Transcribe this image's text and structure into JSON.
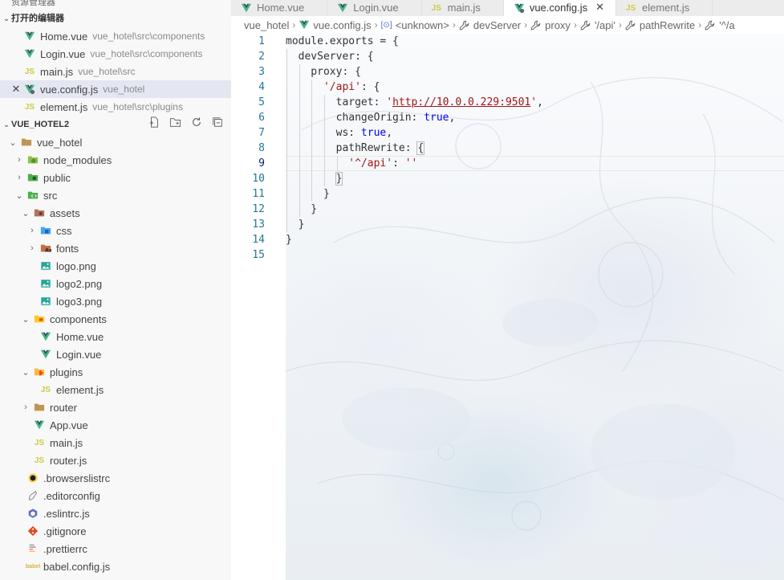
{
  "explorer": {
    "title": "资源管理器",
    "open_editors": {
      "label": "打开的编辑器",
      "items": [
        {
          "name": "Home.vue",
          "path": "vue_hotel\\src\\components",
          "type": "vue"
        },
        {
          "name": "Login.vue",
          "path": "vue_hotel\\src\\components",
          "type": "vue"
        },
        {
          "name": "main.js",
          "path": "vue_hotel\\src",
          "type": "js"
        },
        {
          "name": "vue.config.js",
          "path": "vue_hotel",
          "type": "vueconfig",
          "selected": true
        },
        {
          "name": "element.js",
          "path": "vue_hotel\\src\\plugins",
          "type": "js"
        }
      ]
    },
    "workspace": {
      "label": "VUE_HOTEL2",
      "tree": [
        {
          "name": "vue_hotel",
          "depth": 1,
          "kind": "folder-open",
          "icon": "folder-icon"
        },
        {
          "name": "node_modules",
          "depth": 2,
          "kind": "folder-closed",
          "icon": "node-folder-icon"
        },
        {
          "name": "public",
          "depth": 2,
          "kind": "folder-closed",
          "icon": "public-folder-icon"
        },
        {
          "name": "src",
          "depth": 2,
          "kind": "folder-open",
          "icon": "src-folder-icon"
        },
        {
          "name": "assets",
          "depth": 3,
          "kind": "folder-open",
          "icon": "assets-folder-icon"
        },
        {
          "name": "css",
          "depth": 4,
          "kind": "folder-closed",
          "icon": "css-folder-icon"
        },
        {
          "name": "fonts",
          "depth": 4,
          "kind": "folder-closed",
          "icon": "fonts-folder-icon"
        },
        {
          "name": "logo.png",
          "depth": 4,
          "kind": "file",
          "icon": "image-icon"
        },
        {
          "name": "logo2.png",
          "depth": 4,
          "kind": "file",
          "icon": "image-icon"
        },
        {
          "name": "logo3.png",
          "depth": 4,
          "kind": "file",
          "icon": "image-icon"
        },
        {
          "name": "components",
          "depth": 3,
          "kind": "folder-open",
          "icon": "components-folder-icon"
        },
        {
          "name": "Home.vue",
          "depth": 4,
          "kind": "file",
          "icon": "vue-icon"
        },
        {
          "name": "Login.vue",
          "depth": 4,
          "kind": "file",
          "icon": "vue-icon"
        },
        {
          "name": "plugins",
          "depth": 3,
          "kind": "folder-open",
          "icon": "plugins-folder-icon"
        },
        {
          "name": "element.js",
          "depth": 4,
          "kind": "file",
          "icon": "js-icon"
        },
        {
          "name": "router",
          "depth": 3,
          "kind": "folder-closed",
          "icon": "folder-icon"
        },
        {
          "name": "App.vue",
          "depth": 3,
          "kind": "file",
          "icon": "vue-icon"
        },
        {
          "name": "main.js",
          "depth": 3,
          "kind": "file",
          "icon": "js-icon"
        },
        {
          "name": "router.js",
          "depth": 3,
          "kind": "file",
          "icon": "js-icon"
        },
        {
          "name": ".browserslistrc",
          "depth": 2,
          "kind": "file",
          "icon": "browserslist-icon"
        },
        {
          "name": ".editorconfig",
          "depth": 2,
          "kind": "file",
          "icon": "editorconfig-icon"
        },
        {
          "name": ".eslintrc.js",
          "depth": 2,
          "kind": "file",
          "icon": "eslint-icon"
        },
        {
          "name": ".gitignore",
          "depth": 2,
          "kind": "file",
          "icon": "git-icon"
        },
        {
          "name": ".prettierrc",
          "depth": 2,
          "kind": "file",
          "icon": "prettier-icon"
        },
        {
          "name": "babel.config.js",
          "depth": 2,
          "kind": "file",
          "icon": "babel-icon"
        }
      ]
    }
  },
  "tabs": [
    {
      "label": "Home.vue",
      "type": "vue"
    },
    {
      "label": "Login.vue",
      "type": "vue"
    },
    {
      "label": "main.js",
      "type": "js"
    },
    {
      "label": "vue.config.js",
      "type": "vueconfig",
      "active": true
    },
    {
      "label": "element.js",
      "type": "js"
    }
  ],
  "breadcrumbs": [
    {
      "label": "vue_hotel",
      "icon": ""
    },
    {
      "label": "vue.config.js",
      "icon": "vue-icon"
    },
    {
      "label": "<unknown>",
      "icon": "symbol-icon"
    },
    {
      "label": "devServer",
      "icon": "wrench-icon"
    },
    {
      "label": "proxy",
      "icon": "wrench-icon"
    },
    {
      "label": "'/api'",
      "icon": "wrench-icon"
    },
    {
      "label": "pathRewrite",
      "icon": "wrench-icon"
    },
    {
      "label": "'^/a",
      "icon": "wrench-icon"
    }
  ],
  "editor": {
    "active_line": 9,
    "lines": [
      [
        {
          "t": "module.exports = {",
          "c": "plain"
        }
      ],
      [
        {
          "t": "  devServer: {",
          "c": "plain"
        }
      ],
      [
        {
          "t": "    proxy: {",
          "c": "plain"
        }
      ],
      [
        {
          "t": "      ",
          "c": "plain"
        },
        {
          "t": "'/api'",
          "c": "str"
        },
        {
          "t": ": {",
          "c": "plain"
        }
      ],
      [
        {
          "t": "        target: ",
          "c": "plain"
        },
        {
          "t": "'",
          "c": "str"
        },
        {
          "t": "http://10.0.0.229:9501",
          "c": "url"
        },
        {
          "t": "'",
          "c": "str"
        },
        {
          "t": ",",
          "c": "plain"
        }
      ],
      [
        {
          "t": "        changeOrigin: ",
          "c": "plain"
        },
        {
          "t": "true",
          "c": "bool"
        },
        {
          "t": ",",
          "c": "plain"
        }
      ],
      [
        {
          "t": "        ws: ",
          "c": "plain"
        },
        {
          "t": "true",
          "c": "bool"
        },
        {
          "t": ",",
          "c": "plain"
        }
      ],
      [
        {
          "t": "        pathRewrite: ",
          "c": "plain"
        },
        {
          "t": "{",
          "c": "bracket"
        }
      ],
      [
        {
          "t": "          ",
          "c": "plain"
        },
        {
          "t": "'^/api'",
          "c": "str"
        },
        {
          "t": ": ",
          "c": "plain"
        },
        {
          "t": "''",
          "c": "str"
        }
      ],
      [
        {
          "t": "        ",
          "c": "plain"
        },
        {
          "t": "}",
          "c": "bracket"
        }
      ],
      [
        {
          "t": "      }",
          "c": "plain"
        }
      ],
      [
        {
          "t": "    }",
          "c": "plain"
        }
      ],
      [
        {
          "t": "  }",
          "c": "plain"
        }
      ],
      [
        {
          "t": "}",
          "c": "plain"
        }
      ],
      [
        {
          "t": "",
          "c": "plain"
        }
      ]
    ]
  }
}
